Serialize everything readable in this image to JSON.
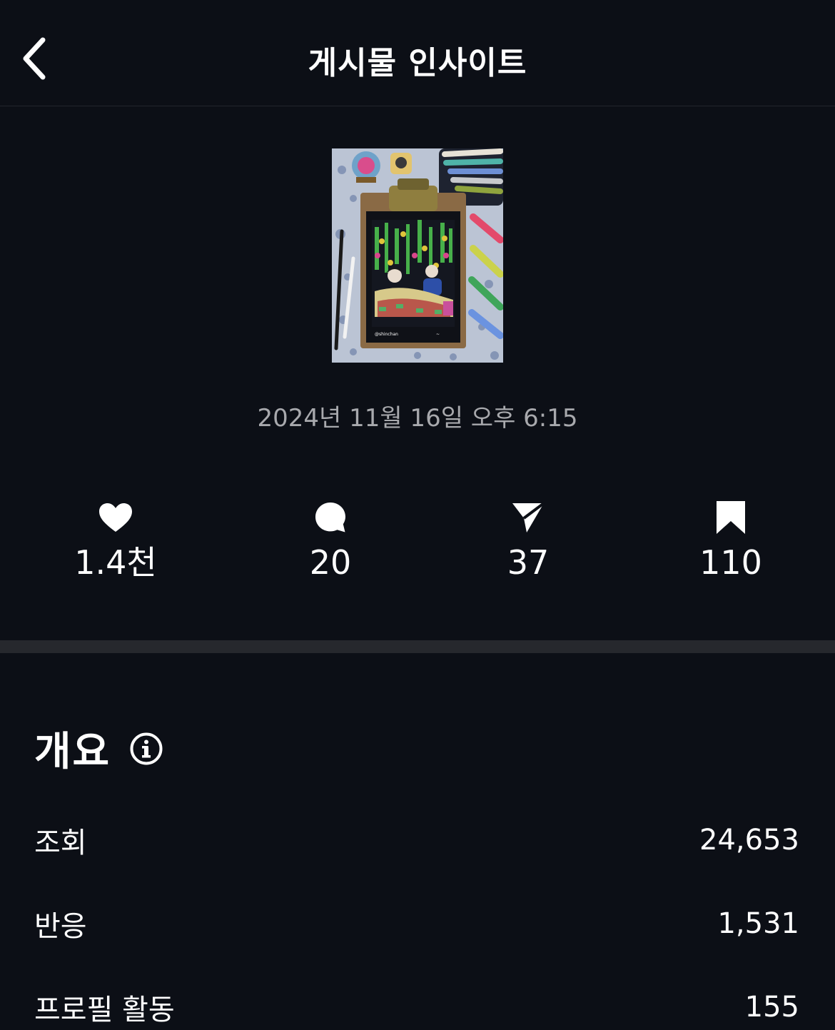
{
  "header": {
    "title": "게시물 인사이트",
    "back_icon": "chevron-left-icon"
  },
  "post": {
    "thumbnail_alt": "post-thumbnail",
    "timestamp": "2024년 11월 16일 오후 6:15"
  },
  "stats": [
    {
      "icon": "heart-icon",
      "value": "1.4천"
    },
    {
      "icon": "comment-icon",
      "value": "20"
    },
    {
      "icon": "send-icon",
      "value": "37"
    },
    {
      "icon": "bookmark-icon",
      "value": "110"
    }
  ],
  "overview": {
    "title": "개요",
    "info_icon": "info-icon",
    "metrics": [
      {
        "label": "조회",
        "value": "24,653"
      },
      {
        "label": "반응",
        "value": "1,531"
      },
      {
        "label": "프로필 활동",
        "value": "155"
      }
    ]
  },
  "colors": {
    "background": "#0c0f16",
    "text": "#ffffff",
    "muted": "#a8a9ad",
    "divider": "#26282d"
  }
}
